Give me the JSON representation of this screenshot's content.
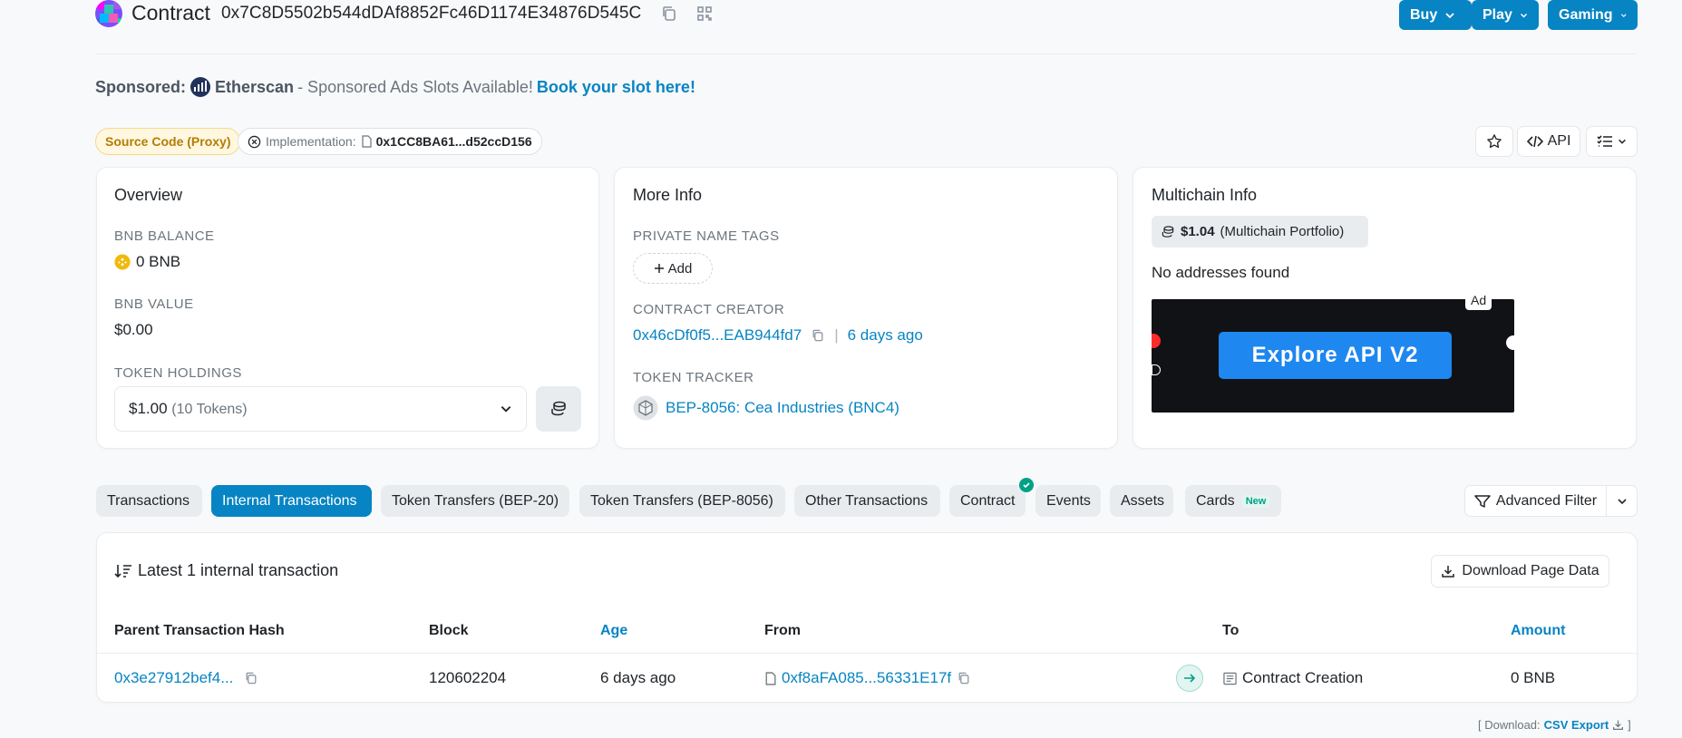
{
  "header": {
    "title": "Contract",
    "address": "0x7C8D5502b544dDAf8852Fc46D1174E34876D545C",
    "buttons": {
      "buy": "Buy",
      "play": "Play",
      "gaming": "Gaming"
    }
  },
  "sponsored": {
    "label": "Sponsored:",
    "brand": "Etherscan",
    "text": "- Sponsored Ads Slots Available!",
    "cta": "Book your slot here!"
  },
  "badges": {
    "source_code": "Source Code (Proxy)",
    "implementation_label": "Implementation:",
    "implementation_hash": "0x1CC8BA61...d52ccD156"
  },
  "toolbar": {
    "api": "API"
  },
  "overview": {
    "title": "Overview",
    "balance_label": "BNB BALANCE",
    "balance_value": "0 BNB",
    "value_label": "BNB VALUE",
    "value_value": "$0.00",
    "holdings_label": "TOKEN HOLDINGS",
    "holdings_amount": "$1.00",
    "holdings_count": "(10 Tokens)"
  },
  "more_info": {
    "title": "More Info",
    "name_tags_label": "PRIVATE NAME TAGS",
    "add_label": "Add",
    "creator_label": "CONTRACT CREATOR",
    "creator_address": "0x46cDf0f5...EAB944fd7",
    "creator_sep": "|",
    "creator_age": "6 days ago",
    "tracker_label": "TOKEN TRACKER",
    "tracker_value": "BEP-8056: Cea Industries (BNC4)"
  },
  "multichain": {
    "title": "Multichain Info",
    "portfolio_amount": "$1.04",
    "portfolio_label": "(Multichain Portfolio)",
    "no_addresses": "No addresses found",
    "ad_tag": "Ad",
    "ad_text": "Explore API V2"
  },
  "tabs": [
    {
      "label": "Transactions"
    },
    {
      "label": "Internal Transactions"
    },
    {
      "label": "Token Transfers (BEP-20)"
    },
    {
      "label": "Token Transfers (BEP-8056)"
    },
    {
      "label": "Other Transactions"
    },
    {
      "label": "Contract"
    },
    {
      "label": "Events"
    },
    {
      "label": "Assets"
    },
    {
      "label": "Cards",
      "badge": "New"
    }
  ],
  "advanced_filter": "Advanced Filter",
  "table": {
    "summary": "Latest 1 internal transaction",
    "download": "Download Page Data",
    "headers": [
      "Parent Transaction Hash",
      "Block",
      "Age",
      "From",
      "To",
      "Amount"
    ],
    "rows": [
      {
        "hash": "0x3e27912bef4...",
        "block": "120602204",
        "age": "6 days ago",
        "from": "0xf8aFA085...56331E17f",
        "to": "Contract Creation",
        "amount": "0 BNB"
      }
    ]
  },
  "footer": {
    "prefix": "[ Download:",
    "link": "CSV Export",
    "suffix": "]"
  },
  "colors": {
    "accent": "#0784c3",
    "warning": "#b47d00",
    "success": "#00a186"
  }
}
